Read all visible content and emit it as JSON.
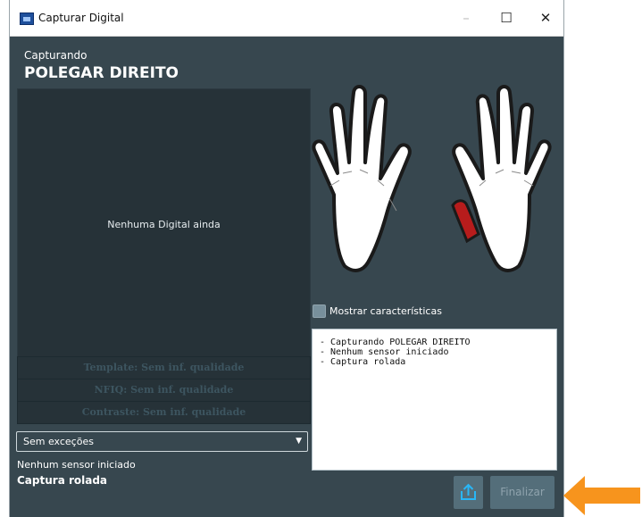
{
  "window": {
    "title": "Capturar Digital",
    "minimize_glyph": "–",
    "maximize_glyph": "☐",
    "close_glyph": "✕"
  },
  "capture": {
    "label": "Capturando",
    "finger": "POLEGAR DIREITO"
  },
  "fingerprint": {
    "empty_message": "Nenhuma Digital ainda",
    "quality": [
      "Template: Sem inf. qualidade",
      "NFIQ: Sem inf. qualidade",
      "Contraste: Sem inf. qualidade"
    ]
  },
  "exceptions": {
    "selected": "Sem exceções"
  },
  "status": {
    "sensor": "Nenhum sensor iniciado",
    "mode": "Captura rolada"
  },
  "hands": {
    "highlight_color": "#b71c1c",
    "highlighted_finger": "right-thumb"
  },
  "show_features": {
    "label": "Mostrar características",
    "checked": false
  },
  "log": {
    "lines": [
      "- Capturando POLEGAR DIREITO",
      "- Nenhum sensor iniciado",
      "- Captura rolada"
    ]
  },
  "buttons": {
    "finalize": "Finalizar",
    "upload_icon": "upload-icon"
  },
  "colors": {
    "window_bg": "#37474f",
    "panel_bg": "#263238",
    "annotation_arrow": "#f7941d"
  }
}
